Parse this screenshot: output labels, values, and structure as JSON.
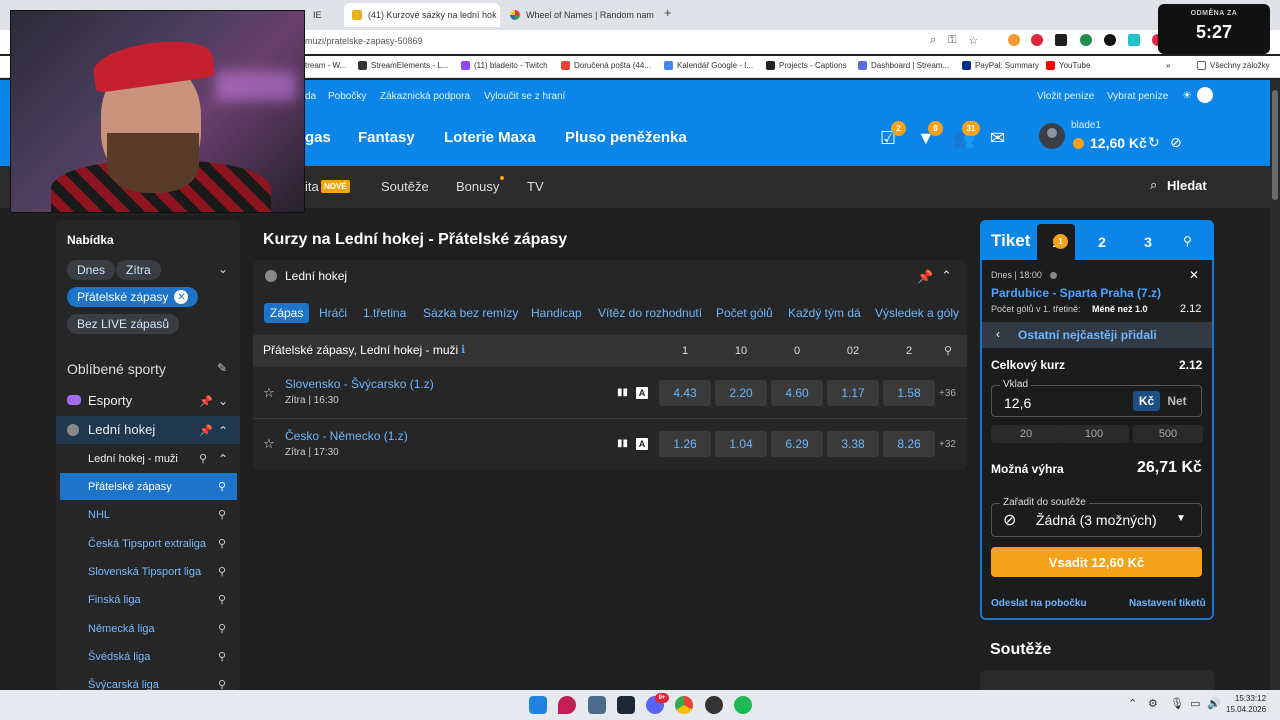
{
  "browser": {
    "tabs": [
      {
        "label": "",
        "active": false
      },
      {
        "label": "(41) Kurzové sázky na lední hok",
        "active": true
      },
      {
        "label": "Wheel of Names | Random nam",
        "active": false
      }
    ],
    "partial_tab": "IE",
    "url": "muzi/pratelske-zapasy-50869",
    "bookmarks": [
      "tream - W...",
      "StreamElements - L...",
      "(11) bladeito - Twitch",
      "Doručená pošta (44...",
      "Kalendář Google - I...",
      "Projects - Captions",
      "Dashboard | Stream...",
      "PayPal: Summary",
      "YouTube",
      "Všechny záložky"
    ]
  },
  "timer": {
    "label": "ODMĚNA ZA",
    "value": "5:27"
  },
  "site": {
    "toplinks": [
      "da",
      "Pobočky",
      "Zákaznická podpora",
      "Vyloučit se z hraní",
      "Vložit peníze",
      "Vybrat peníze"
    ],
    "mainnav": [
      "gas",
      "Fantasy",
      "Loterie Maxa",
      "Pluso peněženka"
    ],
    "badges": {
      "tickets": "2",
      "notifications": "8",
      "friends": "31"
    },
    "user": "blade1",
    "balance": "12,60 Kč",
    "subnav": {
      "partial": "ita",
      "new_badge": "NOVÉ",
      "items": [
        "Soutěže",
        "Bonusy",
        "TV"
      ],
      "search": "Hledat"
    }
  },
  "sidebar": {
    "heading": "Nabídka",
    "chips": [
      "Dnes",
      "Zítra",
      "Přátelské zápasy",
      "Bez LIVE zápasů"
    ],
    "favorites_title": "Oblíbené sporty",
    "sports": [
      "Esporty",
      "Lední hokej"
    ],
    "leagues": [
      "Lední hokej - muži",
      "Přátelské zápasy",
      "NHL",
      "Česká Tipsport extraliga",
      "Slovenská Tipsport liga",
      "Finská liga",
      "Německá liga",
      "Švédská liga",
      "Švýcarská liga"
    ]
  },
  "main": {
    "title": "Kurzy na Lední hokej - Přátelské zápasy",
    "panel_title": "Lední hokej",
    "market_tabs": [
      "Zápas",
      "Hráči",
      "1.třetina",
      "Sázka bez remízy",
      "Handicap",
      "Vítěz do rozhodnutí",
      "Počet gólů",
      "Každý tým dá",
      "Výsledek a góly"
    ],
    "group_title": "Přátelské zápasy, Lední hokej - muži",
    "columns": [
      "1",
      "10",
      "0",
      "02",
      "2"
    ],
    "matches": [
      {
        "name": "Slovensko - Švýcarsko (1.z)",
        "time": "Zítra | 16:30",
        "odds": [
          "4.43",
          "2.20",
          "4.60",
          "1.17",
          "1.58"
        ],
        "more": "+36"
      },
      {
        "name": "Česko - Německo (1.z)",
        "time": "Zítra | 17:30",
        "odds": [
          "1.26",
          "1.04",
          "6.29",
          "3.38",
          "8.26"
        ],
        "more": "+32"
      }
    ]
  },
  "ticket": {
    "title": "Tiket",
    "tabs": [
      "1",
      "2",
      "3"
    ],
    "tab_badge": "1",
    "bet_time": "Dnes | 18:00",
    "bet_match": "Pardubice - Sparta Praha (7.z)",
    "bet_market": "Počet gólů v 1. třetině:",
    "bet_pick": "Méně než 1.0",
    "bet_odd": "2.12",
    "others": "Ostatní nejčastěji přidali",
    "total_label": "Celkový kurz",
    "total_value": "2.12",
    "stake_label": "Vklad",
    "stake_value": "12,6",
    "currency": [
      "Kč",
      "Net"
    ],
    "quick": [
      "20",
      "100",
      "500"
    ],
    "win_label": "Možná výhra",
    "win_value": "26,71 Kč",
    "competition_label": "Zařadit do soutěže",
    "competition_value": "Žádná (3 možných)",
    "bet_button": "Vsadit 12,60 Kč",
    "send_link": "Odeslat na pobočku",
    "settings_link": "Nastavení tiketů"
  },
  "souteze_title": "Soutěže",
  "taskbar": {
    "time": "15:33:12",
    "date": "15.04.2026",
    "discord_badge": "9+"
  }
}
